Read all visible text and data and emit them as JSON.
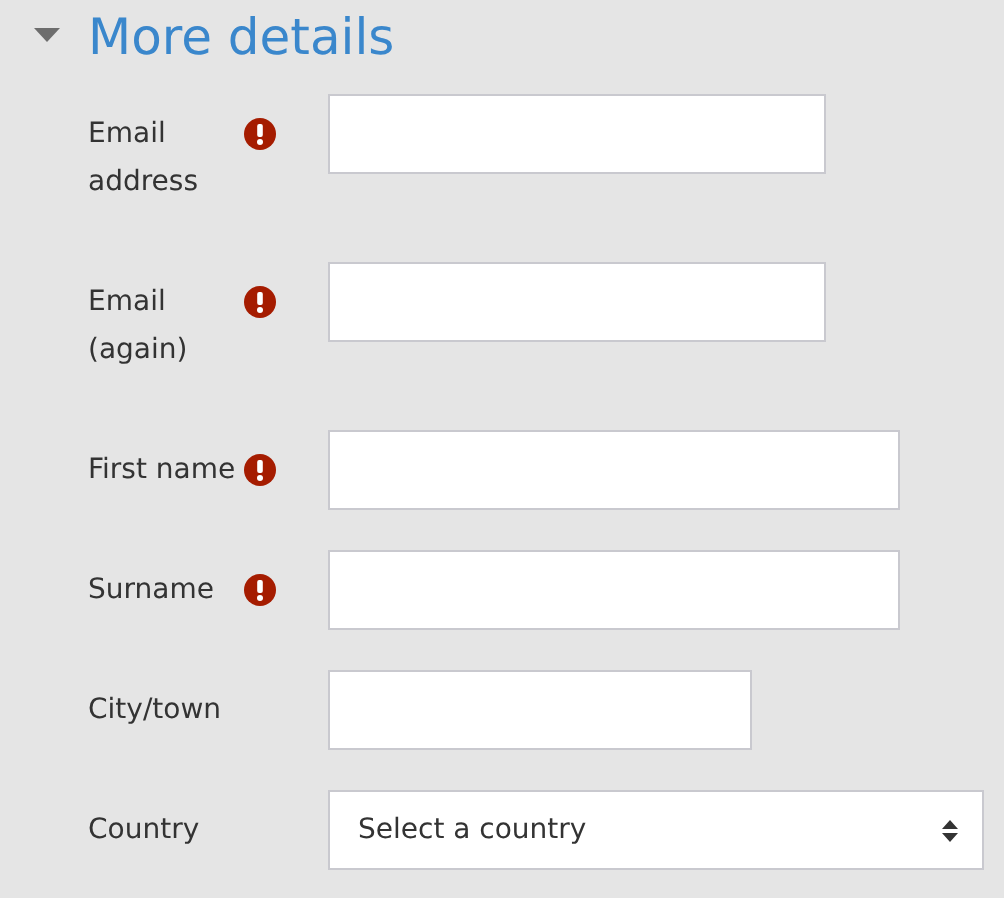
{
  "section": {
    "title": "More details",
    "expanded": true
  },
  "fields": [
    {
      "kind": "text",
      "label": "Email address",
      "required": true
    },
    {
      "kind": "text",
      "label": "Email (again)",
      "required": true
    },
    {
      "kind": "text",
      "label": "First name",
      "required": true
    },
    {
      "kind": "text",
      "label": "Surname",
      "required": true
    },
    {
      "kind": "text",
      "label": "City/town",
      "required": false
    },
    {
      "kind": "select",
      "label": "Country",
      "required": false,
      "value": "Select a country"
    }
  ]
}
